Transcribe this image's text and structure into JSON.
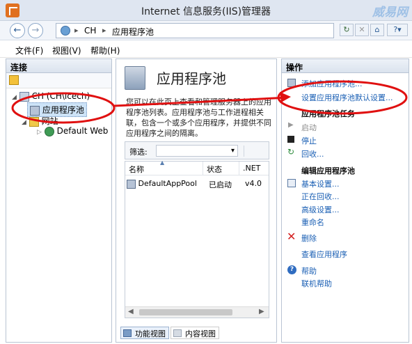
{
  "window": {
    "title": "Internet 信息服务(IIS)管理器",
    "watermark": "威易网"
  },
  "navbar": {
    "breadcrumb": [
      "CH",
      "应用程序池"
    ]
  },
  "menu": [
    "文件(F)",
    "视图(V)",
    "帮助(H)"
  ],
  "connections": {
    "header": "连接",
    "tree": [
      "CH (CH\\icech)",
      "应用程序池",
      "网站",
      "Default Web S"
    ]
  },
  "center": {
    "title": "应用程序池",
    "description": "您可以在此页上查看和管理服务器上的应用程序池列表。应用程序池与工作进程相关联，包含一个或多个应用程序，并提供不同应用程序之间的隔离。",
    "filter_label": "筛选:",
    "columns": [
      "名称",
      "状态",
      ".NET"
    ],
    "rows": [
      {
        "name": "DefaultAppPool",
        "status": "已启动",
        "net": "v4.0"
      }
    ],
    "view_tabs": [
      "功能视图",
      "内容视图"
    ]
  },
  "actions": {
    "header": "操作",
    "add_pool": "添加应用程序池...",
    "set_defaults": "设置应用程序池默认设置...",
    "pool_tasks_header": "应用程序池任务",
    "start": "启动",
    "stop": "停止",
    "recycle": "回收...",
    "edit_header": "编辑应用程序池",
    "basic_settings": "基本设置...",
    "recycling": "正在回收...",
    "advanced_settings": "高级设置...",
    "rename": "重命名",
    "delete": "删除",
    "view_apps": "查看应用程序",
    "help": "帮助",
    "online_help": "联机帮助"
  },
  "colors": {
    "accent_link": "#1a5fb4",
    "annotation_red": "#e01010",
    "selection": "#cde3f7"
  }
}
